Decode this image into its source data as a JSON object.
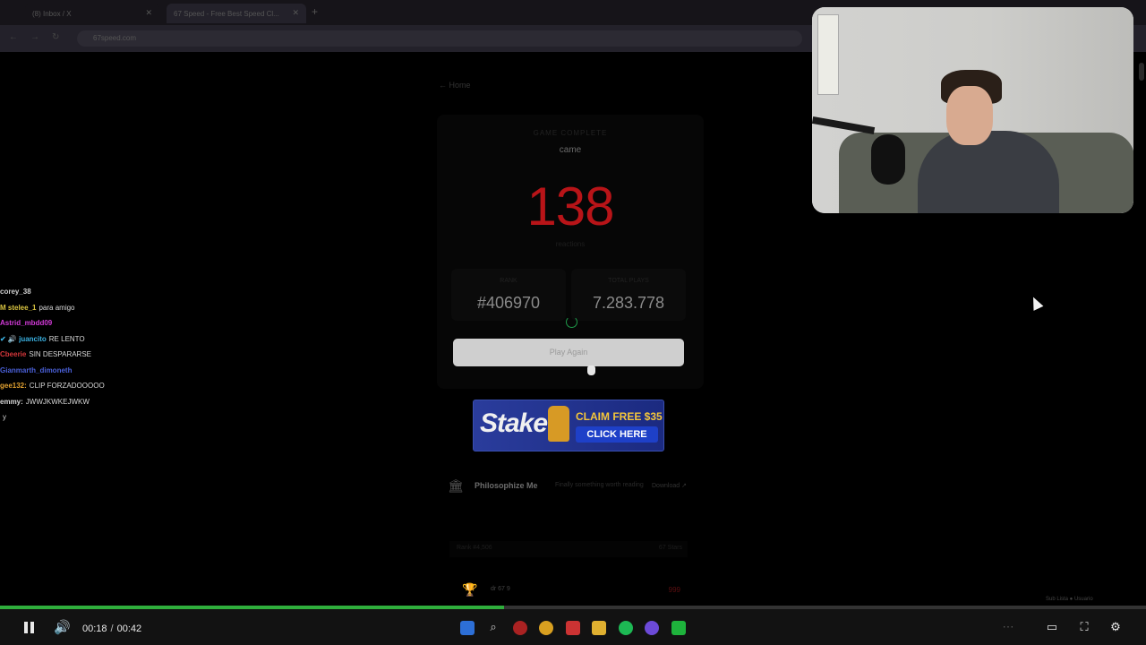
{
  "browser": {
    "tabs": [
      {
        "title": "(8) Inbox / X"
      },
      {
        "title": "67 Speed - Free Best Speed Cl..."
      }
    ],
    "url": "67speed.com"
  },
  "game": {
    "home_link": "← Home",
    "kicker": "GAME COMPLETE",
    "topic": "came",
    "score": "138",
    "score_label": "reactions",
    "rank_label": "RANK",
    "rank": "#406970",
    "total_label": "TOTAL PLAYS",
    "total_plays": "7.283.778",
    "play_again": "Play Again"
  },
  "ad": {
    "brand": "Stake",
    "claim": "CLAIM FREE $35",
    "cta": "CLICK HERE"
  },
  "sponsor": {
    "name": "Philosophize Me",
    "description": "Finally something worth reading",
    "download": "Download ↗"
  },
  "leaderboard": {
    "header_left": "Rank #4,506",
    "header_right": "67 Stars",
    "row_name": "dr 67 9",
    "row_score": "999"
  },
  "chat": [
    {
      "user": "corey_38",
      "text": "",
      "color": "#d0d0d0"
    },
    {
      "user": "M stelee_1",
      "text": "para amigo",
      "color": "#d8c340"
    },
    {
      "user": "Astrid_mbdd09",
      "text": "",
      "color": "#d23ad8"
    },
    {
      "user": "✔ 🔊 juancito",
      "text": "RE LENTO",
      "color": "#3ab0e0"
    },
    {
      "user": "Cbeerie",
      "text": "SIN DESPARARSE",
      "color": "#d4363a"
    },
    {
      "user": "Gianmarth_dimoneth",
      "text": "",
      "color": "#4a60d8"
    },
    {
      "user": "gee132:",
      "text": "CLIP FORZADOOOOO",
      "color": "#e0a030"
    },
    {
      "user": "emmy:",
      "text": "JWWJKWKEJWKW",
      "color": "#d8d8d8"
    },
    {
      "user": "",
      "text": "y",
      "color": "#d8d8d8"
    }
  ],
  "overlay_label": "Sub Lista ● Usuario",
  "player": {
    "current_time": "00:18",
    "duration": "00:42",
    "progress_fraction": 0.44
  },
  "colors": {
    "score_red": "#b81418",
    "progress_green": "#2fae3c",
    "stake_blue": "#2a3c9c",
    "stake_gold": "#f5c63a"
  }
}
